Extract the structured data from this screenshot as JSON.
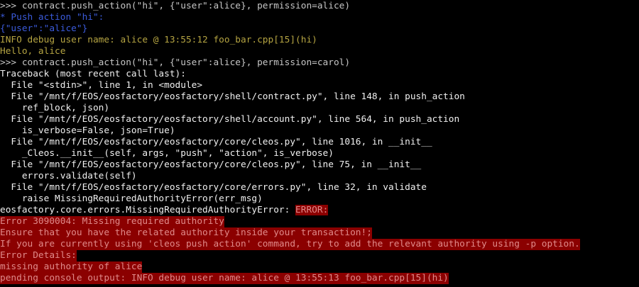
{
  "terminal": {
    "lines": [
      {
        "text": ">>> contract.push_action(\"hi\", {\"user\":alice}, permission=alice)",
        "style": "gray"
      },
      {
        "text": "* Push action \"hi\":",
        "style": "blue"
      },
      {
        "text": "{\"user\":\"alice\"}",
        "style": "blue"
      },
      {
        "text": "INFO debug user name: alice @ 13:55:12 foo_bar.cpp[15](hi)",
        "style": "yellow"
      },
      {
        "text": "Hello, alice",
        "style": "yellow"
      },
      {
        "text": ">>> contract.push_action(\"hi\", {\"user\":alice}, permission=carol)",
        "style": "gray"
      },
      {
        "text": "Traceback (most recent call last):",
        "style": "white"
      },
      {
        "text": "  File \"<stdin>\", line 1, in <module>",
        "style": "white"
      },
      {
        "text": "  File \"/mnt/f/EOS/eosfactory/eosfactory/shell/contract.py\", line 148, in push_action",
        "style": "white"
      },
      {
        "text": "    ref_block, json)",
        "style": "white"
      },
      {
        "text": "  File \"/mnt/f/EOS/eosfactory/eosfactory/shell/account.py\", line 564, in push_action",
        "style": "white"
      },
      {
        "text": "    is_verbose=False, json=True)",
        "style": "white"
      },
      {
        "text": "  File \"/mnt/f/EOS/eosfactory/eosfactory/core/cleos.py\", line 1016, in __init__",
        "style": "white"
      },
      {
        "text": "    _Cleos.__init__(self, args, \"push\", \"action\", is_verbose)",
        "style": "white"
      },
      {
        "text": "  File \"/mnt/f/EOS/eosfactory/eosfactory/core/cleos.py\", line 75, in __init__",
        "style": "white"
      },
      {
        "text": "    errors.validate(self)",
        "style": "white"
      },
      {
        "text": "  File \"/mnt/f/EOS/eosfactory/eosfactory/core/errors.py\", line 32, in validate",
        "style": "white"
      },
      {
        "text": "    raise MissingRequiredAuthorityError(err_msg)",
        "style": "white"
      }
    ],
    "exception_line": {
      "prefix": "eosfactory.core.errors.MissingRequiredAuthorityError: ",
      "badge": "ERROR:"
    },
    "error_lines": [
      "Error 3090004: Missing required authority",
      "Ensure that you have the related authority inside your transaction!;",
      "If you are currently using 'cleos push action' command, try to add the relevant authority using -p option.",
      "Error Details:",
      "missing authority of alice",
      "pending console output: INFO debug user name: alice @ 13:55:13 foo_bar.cpp[15](hi)"
    ],
    "prompt_tail": ">>>"
  },
  "colors": {
    "background": "#000000",
    "text": "#c6c6c6",
    "blue": "#3b5bdb",
    "yellow": "#b5a442",
    "error_bg": "#8b0000",
    "error_text": "#e08a8a"
  }
}
